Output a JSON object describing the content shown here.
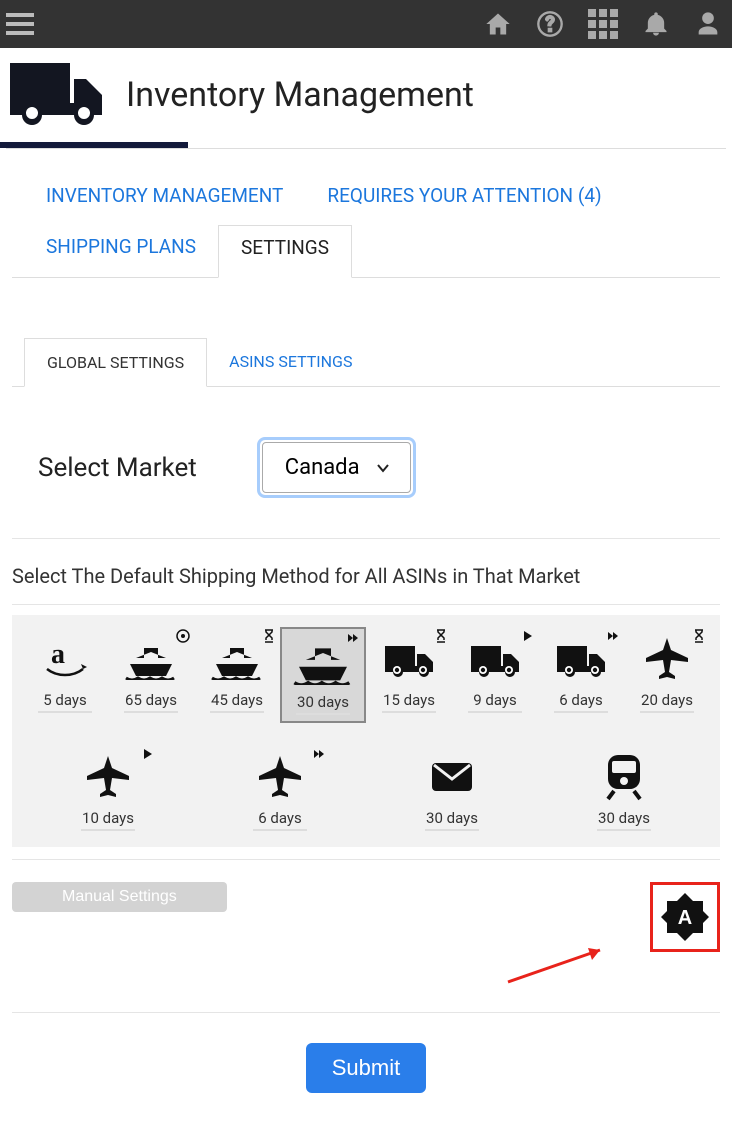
{
  "page_title": "Inventory Management",
  "tabs": {
    "inventory": "INVENTORY MANAGEMENT",
    "attention": "REQUIRES YOUR ATTENTION (4)",
    "shipping": "SHIPPING PLANS",
    "settings": "SETTINGS"
  },
  "subtabs": {
    "global": "GLOBAL SETTINGS",
    "asins": "ASINS SETTINGS"
  },
  "market": {
    "label": "Select Market",
    "selected": "Canada"
  },
  "shipping": {
    "section_label": "Select The Default Shipping Method for All ASINs in That Market",
    "options": [
      {
        "key": "amazon",
        "days": "5 days",
        "badge": null
      },
      {
        "key": "ship-target",
        "days": "65 days",
        "badge": "target"
      },
      {
        "key": "ship-hour",
        "days": "45 days",
        "badge": "hourglass"
      },
      {
        "key": "ship-fast",
        "days": "30 days",
        "badge": "double-arrow",
        "selected": true
      },
      {
        "key": "truck-hour",
        "days": "15 days",
        "badge": "hourglass"
      },
      {
        "key": "truck-play",
        "days": "9 days",
        "badge": "play"
      },
      {
        "key": "truck-fast",
        "days": "6 days",
        "badge": "double-arrow"
      },
      {
        "key": "plane-hour",
        "days": "20 days",
        "badge": "hourglass"
      },
      {
        "key": "plane-play",
        "days": "10 days",
        "badge": "play"
      },
      {
        "key": "plane-fast",
        "days": "6 days",
        "badge": "double-arrow"
      },
      {
        "key": "mail",
        "days": "30 days",
        "badge": null
      },
      {
        "key": "train",
        "days": "30 days",
        "badge": null
      }
    ]
  },
  "mode": {
    "manual_label": "Manual Settings",
    "auto_letter": "A"
  },
  "submit_label": "Submit"
}
